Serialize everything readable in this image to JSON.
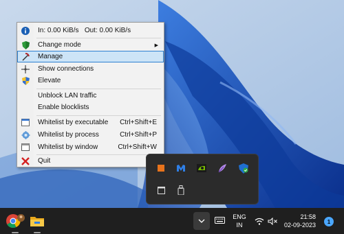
{
  "menu": {
    "stats": {
      "in": "In: 0.00 KiB/s",
      "out": "Out: 0.00 KiB/s"
    },
    "items": [
      {
        "label": "Change mode",
        "icon": "shield-green-icon",
        "submenu": true
      },
      {
        "label": "Manage",
        "icon": "pickaxe-icon",
        "highlighted": true
      },
      {
        "label": "Show connections",
        "icon": "move-arrows-icon"
      },
      {
        "label": "Elevate",
        "icon": "uac-shield-icon"
      },
      {
        "label": "Unblock LAN traffic"
      },
      {
        "label": "Enable blocklists"
      },
      {
        "label": "Whitelist by executable",
        "shortcut": "Ctrl+Shift+E",
        "icon": "executable-icon"
      },
      {
        "label": "Whitelist by process",
        "shortcut": "Ctrl+Shift+P",
        "icon": "process-gear-icon"
      },
      {
        "label": "Whitelist by window",
        "shortcut": "Ctrl+Shift+W",
        "icon": "window-icon"
      },
      {
        "label": "Quit",
        "icon": "red-x-icon"
      }
    ]
  },
  "taskbar": {
    "language": {
      "line1": "ENG",
      "line2": "IN"
    },
    "clock": {
      "time": "21:58",
      "date": "02-09-2023"
    },
    "notification_count": "1",
    "icons": [
      "chrome-icon",
      "file-explorer-icon",
      "show-hidden-icons-chevron",
      "keyboard-icon",
      "wifi-icon",
      "speaker-muted-icon"
    ]
  },
  "tray_flyout": {
    "icons": [
      "firewall-app-icon",
      "malwarebytes-icon",
      "nvidia-icon",
      "feather-icon",
      "defender-shield-icon",
      "window-tray-icon",
      "usb-drive-icon"
    ]
  },
  "colors": {
    "highlight_bg": "#cce4f7",
    "highlight_border": "#2b7fd1",
    "annotation_arrow": "#e0201a",
    "taskbar_bg": "#1f1f1f",
    "flyout_bg": "#2b2b2b"
  }
}
